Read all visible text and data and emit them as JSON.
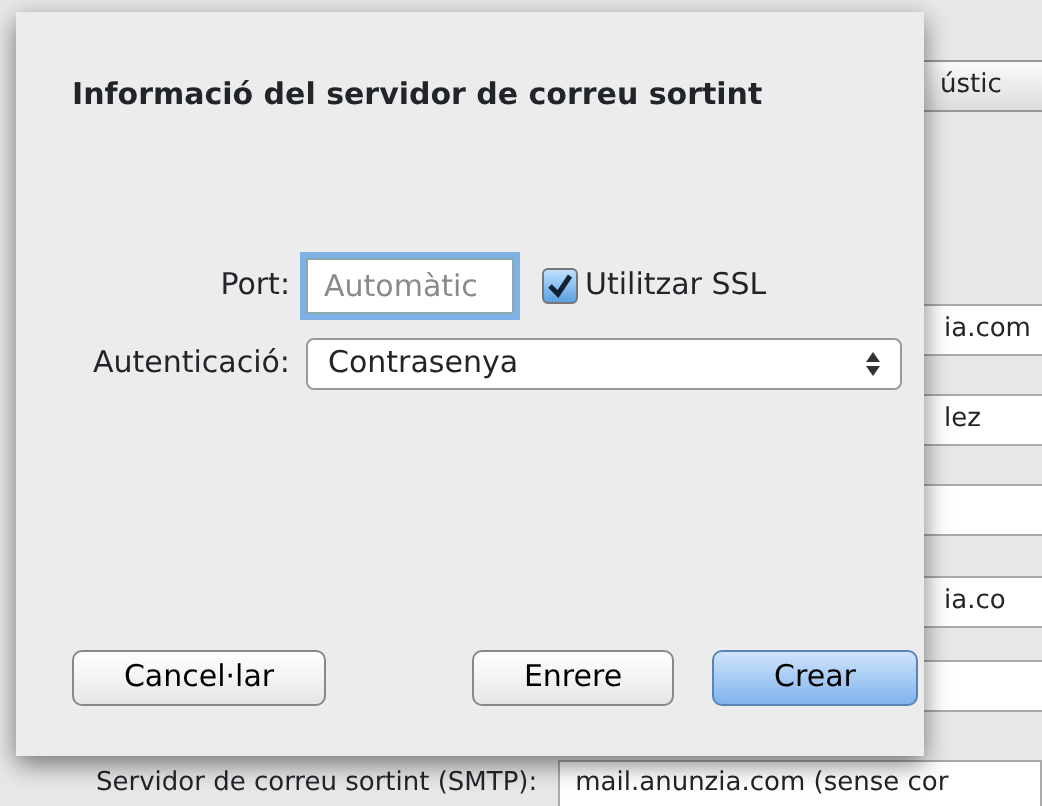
{
  "background_window": {
    "fields": [
      {
        "value": "ústic",
        "kind": "button"
      },
      {
        "value": "ia.com",
        "kind": "field"
      },
      {
        "value": "lez",
        "kind": "field"
      },
      {
        "kind": "field"
      },
      {
        "value": "ia.co",
        "kind": "field"
      },
      {
        "kind": "field"
      }
    ],
    "smtp": {
      "label": "Servidor de correu sortint (SMTP):",
      "value": "mail.anunzia.com (sense cor"
    }
  },
  "dialog": {
    "title": "Informació del servidor de correu sortint",
    "port": {
      "label": "Port:",
      "placeholder": "Automàtic",
      "focused": true
    },
    "ssl": {
      "label": "Utilitzar SSL",
      "checked": true
    },
    "auth": {
      "label": "Autenticació:",
      "value": "Contrasenya"
    },
    "buttons": [
      {
        "label": "Cancel·lar",
        "kind": "default"
      },
      {
        "label": "Enrere",
        "kind": "default"
      },
      {
        "label": "Crear",
        "kind": "primary"
      }
    ]
  }
}
